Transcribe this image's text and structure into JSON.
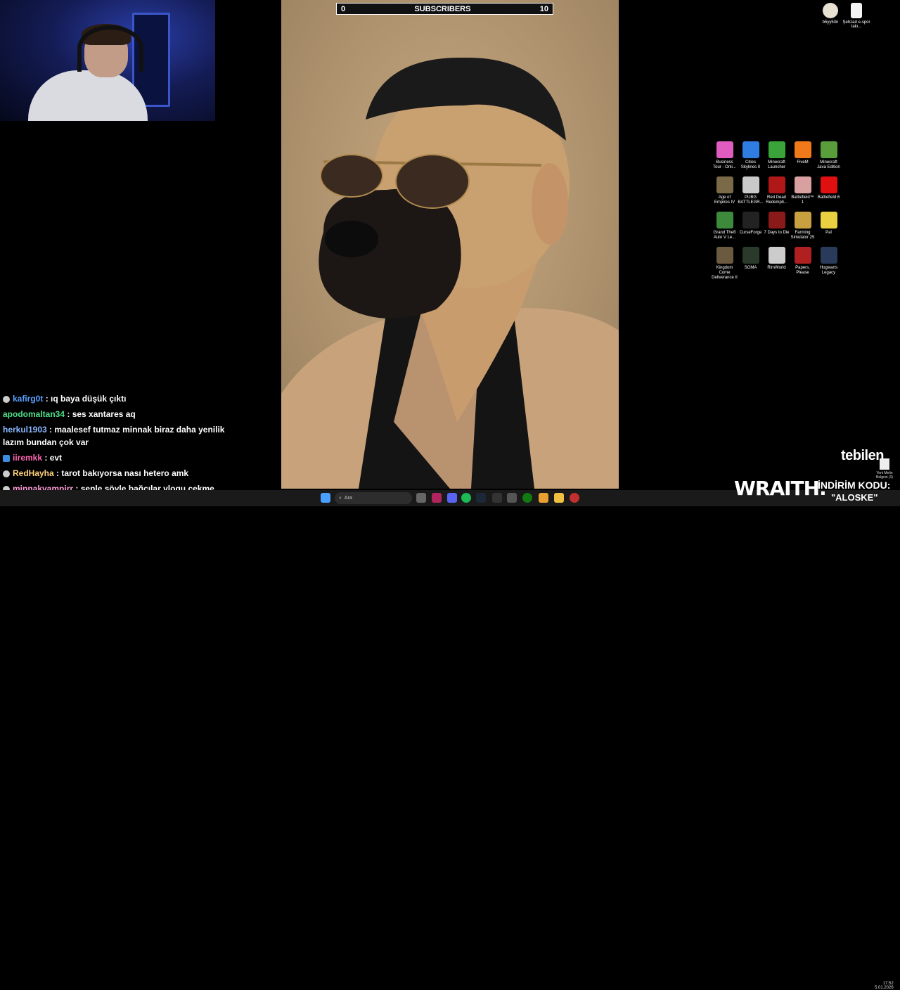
{
  "subscribers": {
    "start": "0",
    "label": "SUBSCRIBERS",
    "end": "10"
  },
  "desktop_top": [
    {
      "label": "b5yy53n",
      "icon": "user-avatar-icon"
    },
    {
      "label": "Şehzad e-spor takı...",
      "icon": "document-icon"
    }
  ],
  "desktop_grid": [
    {
      "label": "Business Tour - Onli...",
      "icon": "business-tour-icon",
      "color": "#e05cc0"
    },
    {
      "label": "Cities Skylines II",
      "icon": "cities-skylines-icon",
      "color": "#2f7de1"
    },
    {
      "label": "Minecraft Launcher",
      "icon": "minecraft-launcher-icon",
      "color": "#3aa33a"
    },
    {
      "label": "FiveM",
      "icon": "fivem-icon",
      "color": "#f07a1a"
    },
    {
      "label": "Minecraft Java Edition",
      "icon": "minecraft-java-icon",
      "color": "#5a9e3c"
    },
    {
      "label": "Age of Empires IV",
      "icon": "age-of-empires-icon",
      "color": "#7a6a48"
    },
    {
      "label": "PUBG BATTLEGR...",
      "icon": "pubg-icon",
      "color": "#c9c9c9"
    },
    {
      "label": "Red Dead Redempti...",
      "icon": "red-dead-icon",
      "color": "#b01818"
    },
    {
      "label": "Battlefield™ 1",
      "icon": "battlefield-1-icon",
      "color": "#d8a0a0"
    },
    {
      "label": "Battlefield 6",
      "icon": "battlefield-6-icon",
      "color": "#e01010"
    },
    {
      "label": "Grand Theft Auto V Le...",
      "icon": "gta-v-icon",
      "color": "#3d8a3d"
    },
    {
      "label": "CurseForge",
      "icon": "curseforge-icon",
      "color": "#222222"
    },
    {
      "label": "7 Days to Die",
      "icon": "seven-days-icon",
      "color": "#8a1a1a"
    },
    {
      "label": "Farming Simulator 25",
      "icon": "farming-sim-icon",
      "color": "#c8a040"
    },
    {
      "label": "Pal",
      "icon": "palworld-icon",
      "color": "#e8d040"
    },
    {
      "label": "Kingdom Come Deliverance II",
      "icon": "kingdom-come-icon",
      "color": "#6a5a40"
    },
    {
      "label": "SOMA",
      "icon": "soma-icon",
      "color": "#2a3a2a"
    },
    {
      "label": "RimWorld",
      "icon": "rimworld-icon",
      "color": "#cccccc"
    },
    {
      "label": "Papers, Please",
      "icon": "papers-please-icon",
      "color": "#b02020"
    },
    {
      "label": "Hogwarts Legacy",
      "icon": "hogwarts-icon",
      "color": "#2a3a5a"
    }
  ],
  "chat": [
    {
      "user": "kafirg0t",
      "text": "ıq baya düşük çıktı",
      "color": "#5aa0ff",
      "badge": "round"
    },
    {
      "user": "apodomaltan34",
      "text": "ses xantares aq",
      "color": "#4fe08a",
      "badge": ""
    },
    {
      "user": "herkul1903",
      "text": "maalesef tutmaz minnak biraz daha yenilik lazım bundan çok var",
      "color": "#8ab8ff",
      "badge": ""
    },
    {
      "user": "iiremkk",
      "text": "evt",
      "color": "#ff69b4",
      "badge": "square"
    },
    {
      "user": "RedHayha",
      "text": "tarot bakıyorsa nası hetero amk",
      "color": "#ffd27a",
      "badge": "round"
    },
    {
      "user": "minnakvampirr",
      "text": "senle şöyle bağcılar vlogu çekme işine ne dedin",
      "color": "#ff9ad8",
      "badge": "round"
    }
  ],
  "taskbar": {
    "search_placeholder": "Ara",
    "clock_time": "17:52",
    "clock_date": "5.01.2026"
  },
  "overlay": {
    "brand": "tebilen",
    "sponsor": "WRAITH.",
    "discount_label": "İNDİRİM KODU:",
    "discount_code": "\"ALOSKE\""
  },
  "recycle_bin": "Yeni Metin Belgesi (3)"
}
